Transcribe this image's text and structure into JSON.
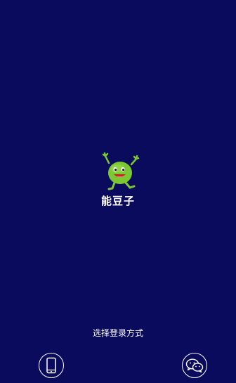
{
  "app": {
    "name": "能豆子",
    "logo_icon": "green-bean-mascot-icon"
  },
  "login": {
    "prompt": "选择登录方式",
    "methods": [
      {
        "id": "phone",
        "icon": "mobile-phone-icon"
      },
      {
        "id": "wechat",
        "icon": "wechat-icon"
      }
    ]
  },
  "colors": {
    "background": "#0b0b5e",
    "text": "#ffffff",
    "mascot_green": "#7cc832"
  }
}
